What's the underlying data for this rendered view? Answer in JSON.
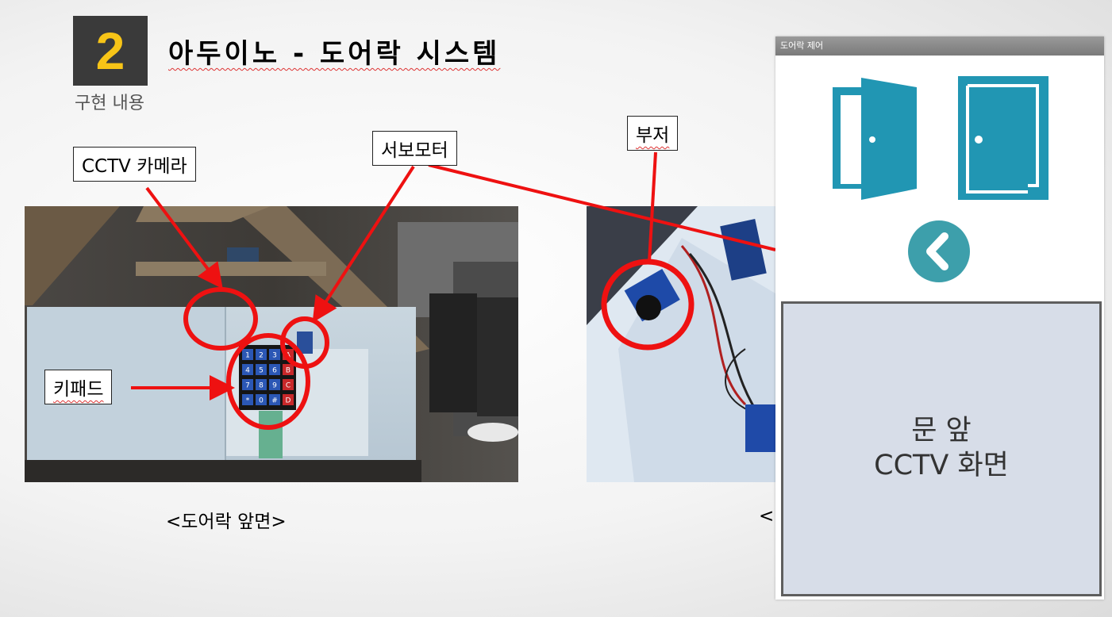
{
  "slide": {
    "section_number": "2",
    "title": "아두이노 - 도어락 시스템",
    "subtitle": "구현 내용"
  },
  "labels": {
    "cctv_camera": "CCTV 카메라",
    "servo_motor": "서보모터",
    "buzzer": "부저",
    "keypad": "키패드"
  },
  "keypad_keys": [
    "1",
    "2",
    "3",
    "A",
    "4",
    "5",
    "6",
    "B",
    "7",
    "8",
    "9",
    "C",
    "*",
    "0",
    "#",
    "D"
  ],
  "captions": {
    "front": "<도어락 앞면>",
    "second_partial": "<"
  },
  "app": {
    "window_title": "도어락 제어",
    "cctv_line1": "문 앞",
    "cctv_line2": "CCTV 화면"
  },
  "colors": {
    "number_badge_bg": "#3a3a3a",
    "number_text": "#f7c417",
    "annotation": "#ee1111",
    "door_icon": "#2196b3",
    "back_button": "#3d9fab",
    "cctv_bg": "#d7dde8"
  },
  "icons": [
    "door-open-icon",
    "door-closed-icon",
    "chevron-left-icon"
  ]
}
